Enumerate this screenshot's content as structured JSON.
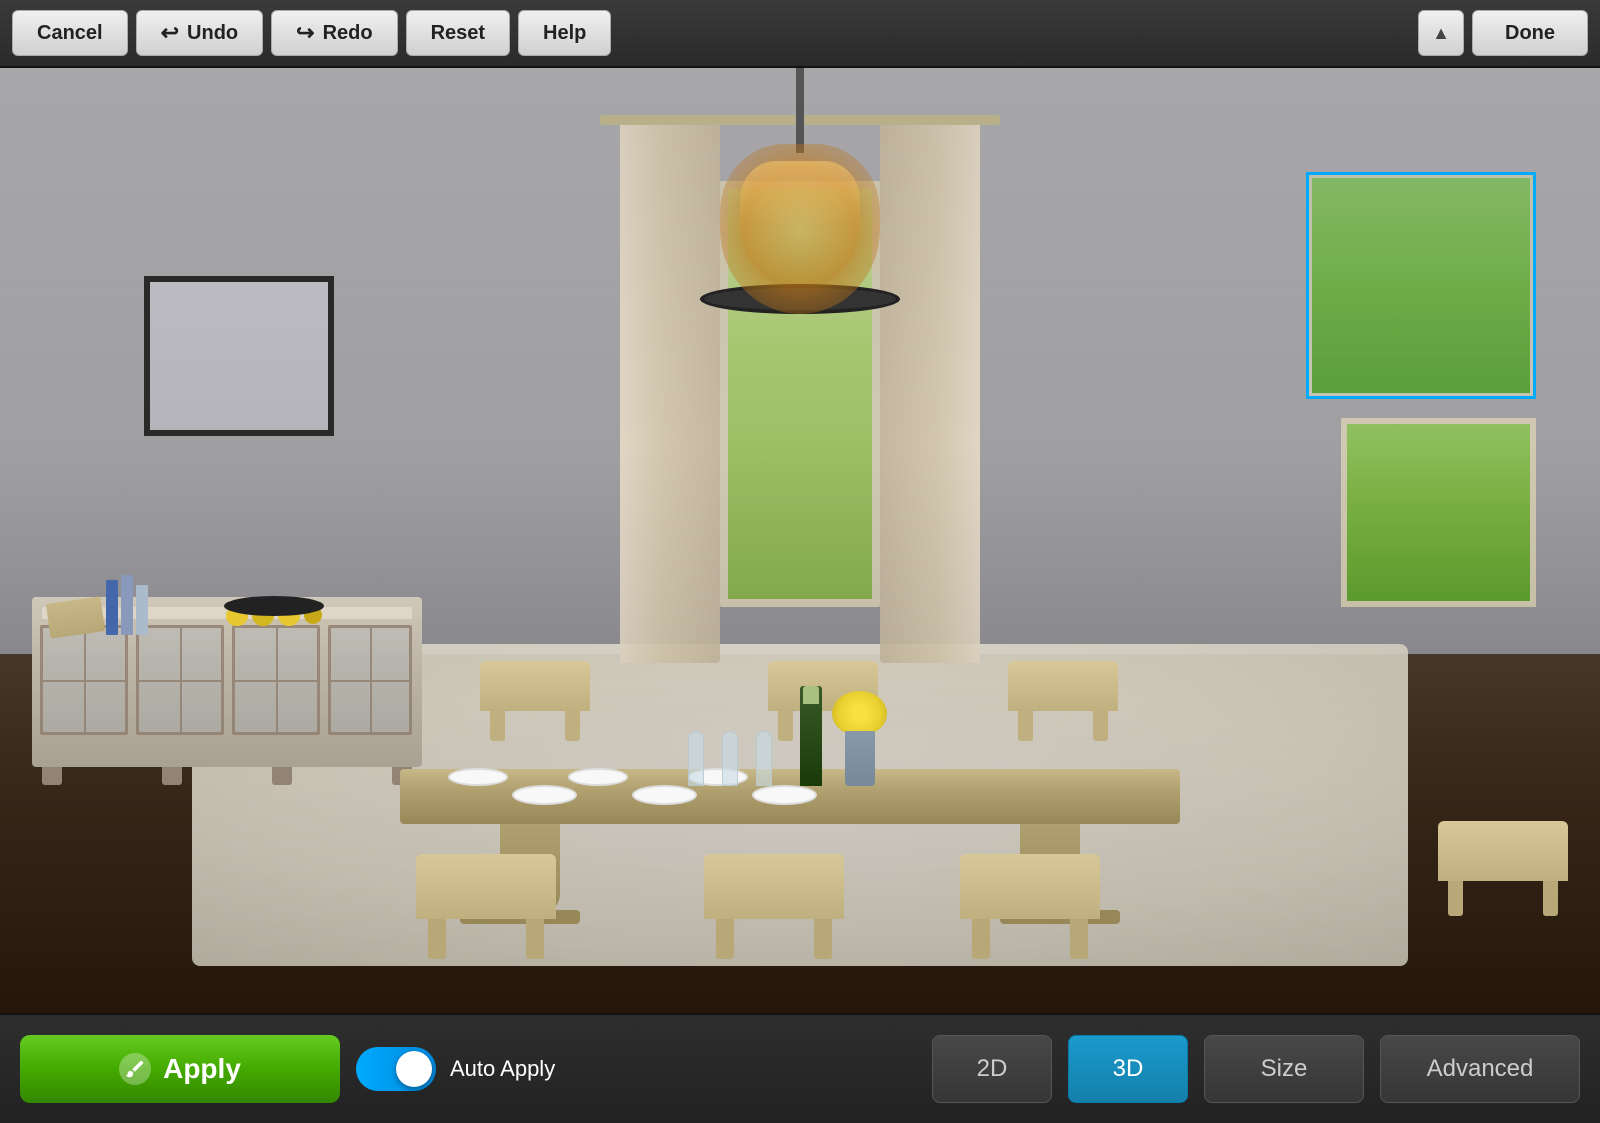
{
  "toolbar": {
    "cancel_label": "Cancel",
    "undo_label": "Undo",
    "redo_label": "Redo",
    "reset_label": "Reset",
    "help_label": "Help",
    "done_label": "Done",
    "collapse_icon": "▲"
  },
  "bottom_toolbar": {
    "apply_label": "Apply",
    "auto_apply_label": "Auto Apply",
    "btn_2d_label": "2D",
    "btn_3d_label": "3D",
    "size_label": "Size",
    "advanced_label": "Advanced",
    "active_view": "3D"
  },
  "scene": {
    "description": "3D Dining Room Interior Visualization",
    "selection_hint": "Window selected (blue outline)"
  },
  "icons": {
    "undo_arrow": "↩",
    "redo_arrow": "↪",
    "apply_eraser": "✏"
  }
}
